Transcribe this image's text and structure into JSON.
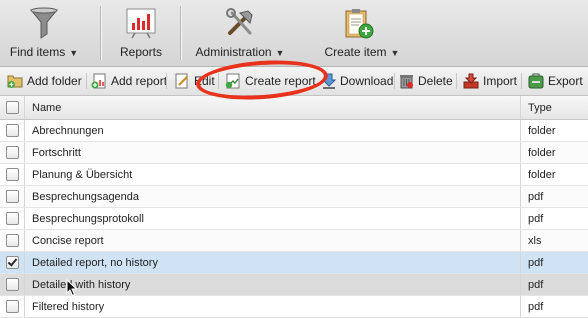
{
  "ribbon": {
    "find_items": "Find items",
    "reports": "Reports",
    "administration": "Administration",
    "create_item": "Create item"
  },
  "toolbar": {
    "add_folder": "Add folder",
    "add_report": "Add report",
    "edit": "Edit",
    "create_report": "Create report",
    "download": "Download",
    "delete": "Delete",
    "import": "Import",
    "export": "Export"
  },
  "table": {
    "columns": {
      "name": "Name",
      "type": "Type"
    },
    "rows": [
      {
        "name": "Abrechnungen",
        "type": "folder",
        "checked": false
      },
      {
        "name": "Fortschritt",
        "type": "folder",
        "checked": false
      },
      {
        "name": "Planung & Übersicht",
        "type": "folder",
        "checked": false
      },
      {
        "name": "Besprechungsagenda",
        "type": "pdf",
        "checked": false
      },
      {
        "name": "Besprechungsprotokoll",
        "type": "pdf",
        "checked": false
      },
      {
        "name": "Concise report",
        "type": "xls",
        "checked": false
      },
      {
        "name": "Detailed report, no history",
        "type": "pdf",
        "checked": true
      },
      {
        "name": "Detailed with history",
        "type": "pdf",
        "checked": false
      },
      {
        "name": "Filtered history",
        "type": "pdf",
        "checked": false
      }
    ]
  },
  "colors": {
    "highlight": "#e8321c",
    "selected_row": "#cfe3f4"
  }
}
